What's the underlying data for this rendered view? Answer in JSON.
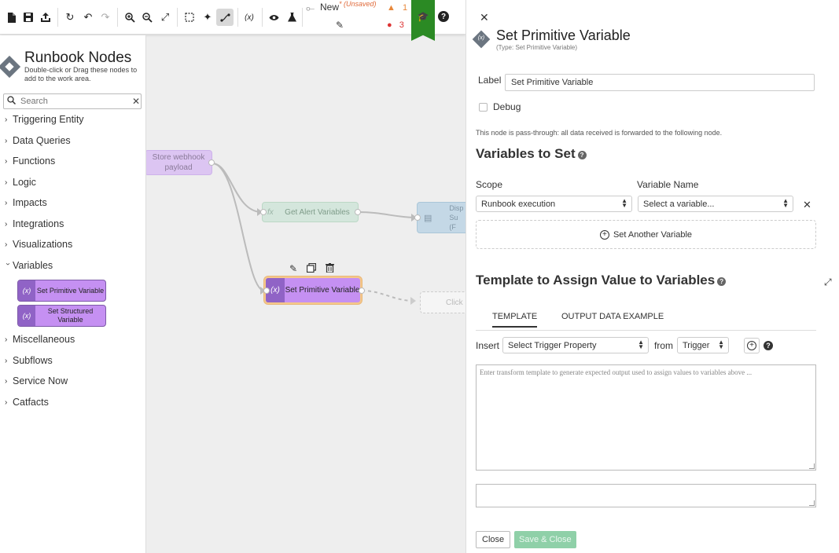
{
  "toolbar": {
    "flow_name": "New",
    "unsaved": "* (Unsaved)",
    "warnings_count": "1",
    "errors_count": "3",
    "variables_icon": "(x)"
  },
  "left_panel": {
    "title": "Runbook Nodes",
    "subtitle": "Double-click or Drag these nodes to add to the work area.",
    "search_placeholder": "Search",
    "categories": [
      "Triggering Entity",
      "Data Queries",
      "Functions",
      "Logic",
      "Impacts",
      "Integrations",
      "Visualizations",
      "Variables",
      "Miscellaneous",
      "Subflows",
      "Service Now",
      "Catfacts"
    ],
    "variable_nodes": [
      "Set Primitive Variable",
      "Set Structured Variable"
    ],
    "node_icon_text": "(x)"
  },
  "canvas": {
    "nodes": {
      "store_webhook": "Store webhook payload",
      "get_alert": "Get Alert Variables",
      "display": "Disp\nSu\n(F",
      "selected": "Set Primitive Variable",
      "click": "Click"
    },
    "fx_label": "fx",
    "node_icon_text": "(x)"
  },
  "panel": {
    "logo_text": "(x)",
    "title": "Set Primitive Variable",
    "type_label": "(Type: Set Primitive Variable)",
    "label_caption": "Label",
    "label_value": "Set Primitive Variable",
    "debug_label": "Debug",
    "pass_through_note": "This node is pass-through: all data received is forwarded to the following node.",
    "variables_heading": "Variables to Set",
    "scope_header": "Scope",
    "variable_name_header": "Variable Name",
    "scope_value": "Runbook execution",
    "variable_placeholder": "Select a variable...",
    "add_variable_label": "Set Another Variable",
    "template_heading": "Template to Assign Value to Variables",
    "tabs": [
      "TEMPLATE",
      "OUTPUT DATA EXAMPLE"
    ],
    "insert_label": "Insert",
    "insert_value": "Select Trigger Property",
    "from_label": "from",
    "from_value": "Trigger",
    "template_placeholder": "Enter transform template to generate expected output used to assign values to variables above ...",
    "close_button": "Close",
    "save_button": "Save & Close"
  },
  "colors": {
    "ribbon": "#2b8a24",
    "variable_node": "#c590f2",
    "save_button": "#8fd0a8",
    "warning": "#e8873a",
    "error": "#d33333"
  }
}
